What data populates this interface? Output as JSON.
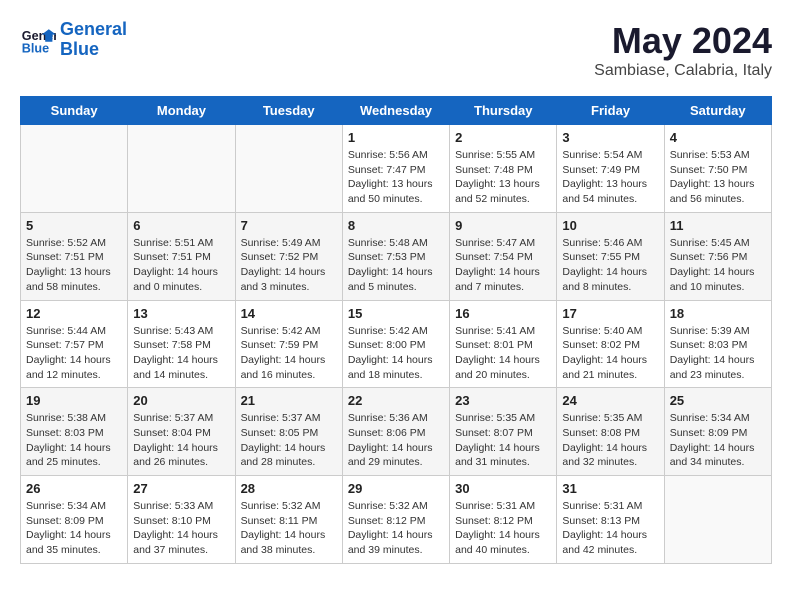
{
  "header": {
    "logo_line1": "General",
    "logo_line2": "Blue",
    "main_title": "May 2024",
    "subtitle": "Sambiase, Calabria, Italy"
  },
  "days_of_week": [
    "Sunday",
    "Monday",
    "Tuesday",
    "Wednesday",
    "Thursday",
    "Friday",
    "Saturday"
  ],
  "weeks": [
    [
      {
        "day": "",
        "info": ""
      },
      {
        "day": "",
        "info": ""
      },
      {
        "day": "",
        "info": ""
      },
      {
        "day": "1",
        "info": "Sunrise: 5:56 AM\nSunset: 7:47 PM\nDaylight: 13 hours\nand 50 minutes."
      },
      {
        "day": "2",
        "info": "Sunrise: 5:55 AM\nSunset: 7:48 PM\nDaylight: 13 hours\nand 52 minutes."
      },
      {
        "day": "3",
        "info": "Sunrise: 5:54 AM\nSunset: 7:49 PM\nDaylight: 13 hours\nand 54 minutes."
      },
      {
        "day": "4",
        "info": "Sunrise: 5:53 AM\nSunset: 7:50 PM\nDaylight: 13 hours\nand 56 minutes."
      }
    ],
    [
      {
        "day": "5",
        "info": "Sunrise: 5:52 AM\nSunset: 7:51 PM\nDaylight: 13 hours\nand 58 minutes."
      },
      {
        "day": "6",
        "info": "Sunrise: 5:51 AM\nSunset: 7:51 PM\nDaylight: 14 hours\nand 0 minutes."
      },
      {
        "day": "7",
        "info": "Sunrise: 5:49 AM\nSunset: 7:52 PM\nDaylight: 14 hours\nand 3 minutes."
      },
      {
        "day": "8",
        "info": "Sunrise: 5:48 AM\nSunset: 7:53 PM\nDaylight: 14 hours\nand 5 minutes."
      },
      {
        "day": "9",
        "info": "Sunrise: 5:47 AM\nSunset: 7:54 PM\nDaylight: 14 hours\nand 7 minutes."
      },
      {
        "day": "10",
        "info": "Sunrise: 5:46 AM\nSunset: 7:55 PM\nDaylight: 14 hours\nand 8 minutes."
      },
      {
        "day": "11",
        "info": "Sunrise: 5:45 AM\nSunset: 7:56 PM\nDaylight: 14 hours\nand 10 minutes."
      }
    ],
    [
      {
        "day": "12",
        "info": "Sunrise: 5:44 AM\nSunset: 7:57 PM\nDaylight: 14 hours\nand 12 minutes."
      },
      {
        "day": "13",
        "info": "Sunrise: 5:43 AM\nSunset: 7:58 PM\nDaylight: 14 hours\nand 14 minutes."
      },
      {
        "day": "14",
        "info": "Sunrise: 5:42 AM\nSunset: 7:59 PM\nDaylight: 14 hours\nand 16 minutes."
      },
      {
        "day": "15",
        "info": "Sunrise: 5:42 AM\nSunset: 8:00 PM\nDaylight: 14 hours\nand 18 minutes."
      },
      {
        "day": "16",
        "info": "Sunrise: 5:41 AM\nSunset: 8:01 PM\nDaylight: 14 hours\nand 20 minutes."
      },
      {
        "day": "17",
        "info": "Sunrise: 5:40 AM\nSunset: 8:02 PM\nDaylight: 14 hours\nand 21 minutes."
      },
      {
        "day": "18",
        "info": "Sunrise: 5:39 AM\nSunset: 8:03 PM\nDaylight: 14 hours\nand 23 minutes."
      }
    ],
    [
      {
        "day": "19",
        "info": "Sunrise: 5:38 AM\nSunset: 8:03 PM\nDaylight: 14 hours\nand 25 minutes."
      },
      {
        "day": "20",
        "info": "Sunrise: 5:37 AM\nSunset: 8:04 PM\nDaylight: 14 hours\nand 26 minutes."
      },
      {
        "day": "21",
        "info": "Sunrise: 5:37 AM\nSunset: 8:05 PM\nDaylight: 14 hours\nand 28 minutes."
      },
      {
        "day": "22",
        "info": "Sunrise: 5:36 AM\nSunset: 8:06 PM\nDaylight: 14 hours\nand 29 minutes."
      },
      {
        "day": "23",
        "info": "Sunrise: 5:35 AM\nSunset: 8:07 PM\nDaylight: 14 hours\nand 31 minutes."
      },
      {
        "day": "24",
        "info": "Sunrise: 5:35 AM\nSunset: 8:08 PM\nDaylight: 14 hours\nand 32 minutes."
      },
      {
        "day": "25",
        "info": "Sunrise: 5:34 AM\nSunset: 8:09 PM\nDaylight: 14 hours\nand 34 minutes."
      }
    ],
    [
      {
        "day": "26",
        "info": "Sunrise: 5:34 AM\nSunset: 8:09 PM\nDaylight: 14 hours\nand 35 minutes."
      },
      {
        "day": "27",
        "info": "Sunrise: 5:33 AM\nSunset: 8:10 PM\nDaylight: 14 hours\nand 37 minutes."
      },
      {
        "day": "28",
        "info": "Sunrise: 5:32 AM\nSunset: 8:11 PM\nDaylight: 14 hours\nand 38 minutes."
      },
      {
        "day": "29",
        "info": "Sunrise: 5:32 AM\nSunset: 8:12 PM\nDaylight: 14 hours\nand 39 minutes."
      },
      {
        "day": "30",
        "info": "Sunrise: 5:31 AM\nSunset: 8:12 PM\nDaylight: 14 hours\nand 40 minutes."
      },
      {
        "day": "31",
        "info": "Sunrise: 5:31 AM\nSunset: 8:13 PM\nDaylight: 14 hours\nand 42 minutes."
      },
      {
        "day": "",
        "info": ""
      }
    ]
  ]
}
